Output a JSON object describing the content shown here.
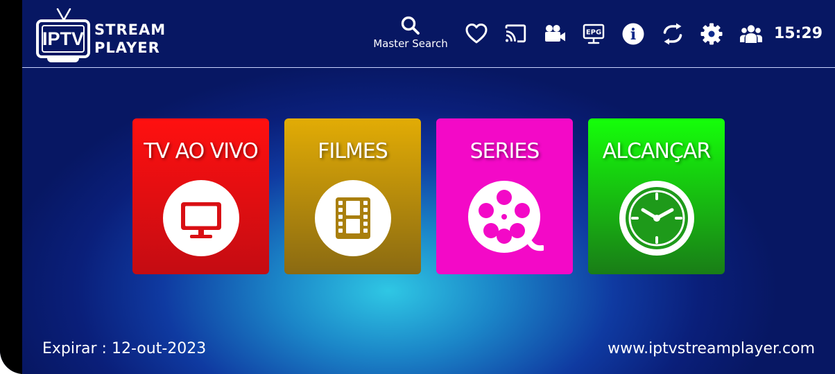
{
  "brand": {
    "logo_mark": "IPTV",
    "line1": "STREAM",
    "line2": "PLAYER"
  },
  "header": {
    "search_label": "Master Search",
    "icons": [
      "search-icon",
      "heart-icon",
      "cast-icon",
      "video-camera-icon",
      "epg-icon",
      "info-icon",
      "refresh-icon",
      "gear-icon",
      "users-icon"
    ],
    "epg_text": "EPG",
    "info_text": "i",
    "time": "15:29"
  },
  "tiles": [
    {
      "label": "TV AO VIVO",
      "icon": "tv-icon",
      "color": "#ff1010"
    },
    {
      "label": "FILMES",
      "icon": "film-icon",
      "color": "#e2ac05"
    },
    {
      "label": "SERIES",
      "icon": "film-reel-icon",
      "color": "#f309c7"
    },
    {
      "label": "ALCANÇAR",
      "icon": "clock-icon",
      "color": "#15ff0a"
    }
  ],
  "footer": {
    "expiry": "Expirar : 12-out-2023",
    "website": "www.iptvstreamplayer.com"
  },
  "colors": {
    "background_center": "#2fc7e4",
    "background_edge": "#071763",
    "text": "#ffffff"
  }
}
